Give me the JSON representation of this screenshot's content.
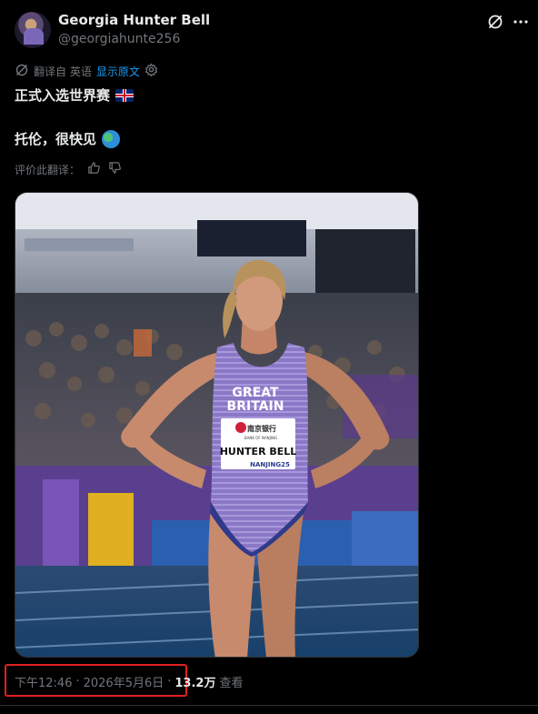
{
  "user": {
    "name": "Georgia Hunter Bell",
    "handle": "@georgiahunte256"
  },
  "translation": {
    "label": "翻译自 英语",
    "show_original": "显示原文"
  },
  "tweet": {
    "line1": "正式入选世界赛",
    "line2": "托伦，很快见"
  },
  "rating": {
    "label": "评价此翻译："
  },
  "photo": {
    "bib_line1": "GREAT",
    "bib_line2": "BRITAIN",
    "bank_label": "南京银行",
    "bank_sub": "BANK OF NANJING",
    "bib_name": "HUNTER BELL",
    "bib_sponsor": "NANJING25"
  },
  "meta": {
    "time": "下午12:46",
    "sep1": "·",
    "date": "2026年5月6日",
    "sep2": "·",
    "views": "13.2万",
    "views_label": "查看"
  },
  "colors": {
    "background": "#000000",
    "text": "#e7e9ea",
    "muted": "#71767b",
    "link": "#1d9bf0",
    "highlight_box": "#e02020"
  },
  "icons": {
    "grok": "grok-icon",
    "more": "more-icon",
    "translate": "translate-icon",
    "settings": "gear-icon",
    "thumbs_up": "thumbs-up-icon",
    "thumbs_down": "thumbs-down-icon"
  }
}
